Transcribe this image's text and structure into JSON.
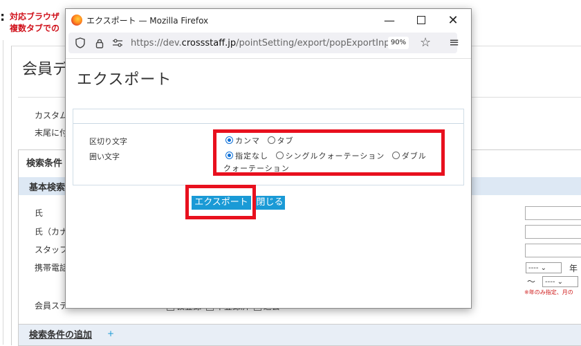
{
  "background": {
    "notice_line1": "対応ブラウザ",
    "notice_line2": "複数タブでの",
    "page_title": "会員デ",
    "label_custom": "カスタム",
    "label_suffix": "末尾に付",
    "search_conditions": "検索条件",
    "basic_search": "基本検索",
    "field_family_name": "氏",
    "field_family_kana": "氏（カナ",
    "field_staff": "スタッフ",
    "field_mobile": "携帯電話",
    "field_member_status": "会員ステ",
    "status_opt1": "仮登録",
    "status_opt2": "本登録済",
    "status_opt3": "退会",
    "year_select": "----",
    "year_unit": "年",
    "range_tilde": "〜",
    "month_select": "----",
    "note": "※年のみ指定、月の",
    "add_conditions": "検索条件の追加",
    "add_plus": "+"
  },
  "window": {
    "title": "エクスポート — Mozilla Firefox",
    "url_prefix": "https://dev.",
    "url_domain": "crossstaff.jp",
    "url_path": "/pointSetting/export/popExportInput",
    "zoom": "90%"
  },
  "dialog": {
    "heading": "エクスポート",
    "delimiter_label": "区切り文字",
    "quote_label": "囲い文字",
    "delimiter_options": [
      "カンマ",
      "タブ"
    ],
    "delimiter_selected": "カンマ",
    "quote_options": [
      "指定なし",
      "シングルクォーテーション",
      "ダブルクォーテーション"
    ],
    "quote_option_double_line1": "ダブル",
    "quote_option_double_line2": "クォーテーション",
    "quote_selected": "指定なし",
    "export_button": "エクスポート",
    "close_button": "閉じる"
  },
  "colors": {
    "highlight": "#e8101e",
    "button": "#1a9ad6",
    "notice": "#d0101a"
  }
}
